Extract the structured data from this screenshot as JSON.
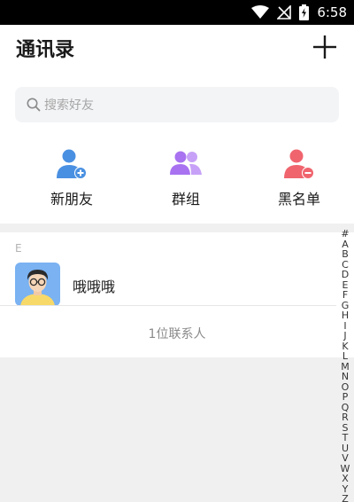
{
  "status_bar": {
    "time": "6:58"
  },
  "header": {
    "title": "通讯录"
  },
  "search": {
    "placeholder": "搜索好友"
  },
  "quick_actions": [
    {
      "label": "新朋友",
      "icon": "add-user-icon",
      "color": "#4a90e2"
    },
    {
      "label": "群组",
      "icon": "group-icon",
      "color": "#a872f0"
    },
    {
      "label": "黑名单",
      "icon": "block-user-icon",
      "color": "#f0646e"
    }
  ],
  "contacts": {
    "section_letter": "E",
    "items": [
      {
        "name": "哦哦哦"
      }
    ],
    "count_text": "1位联系人"
  },
  "alpha_index": [
    "#",
    "A",
    "B",
    "C",
    "D",
    "E",
    "F",
    "G",
    "H",
    "I",
    "J",
    "K",
    "L",
    "M",
    "N",
    "O",
    "P",
    "Q",
    "R",
    "S",
    "T",
    "U",
    "V",
    "W",
    "X",
    "Y",
    "Z"
  ]
}
